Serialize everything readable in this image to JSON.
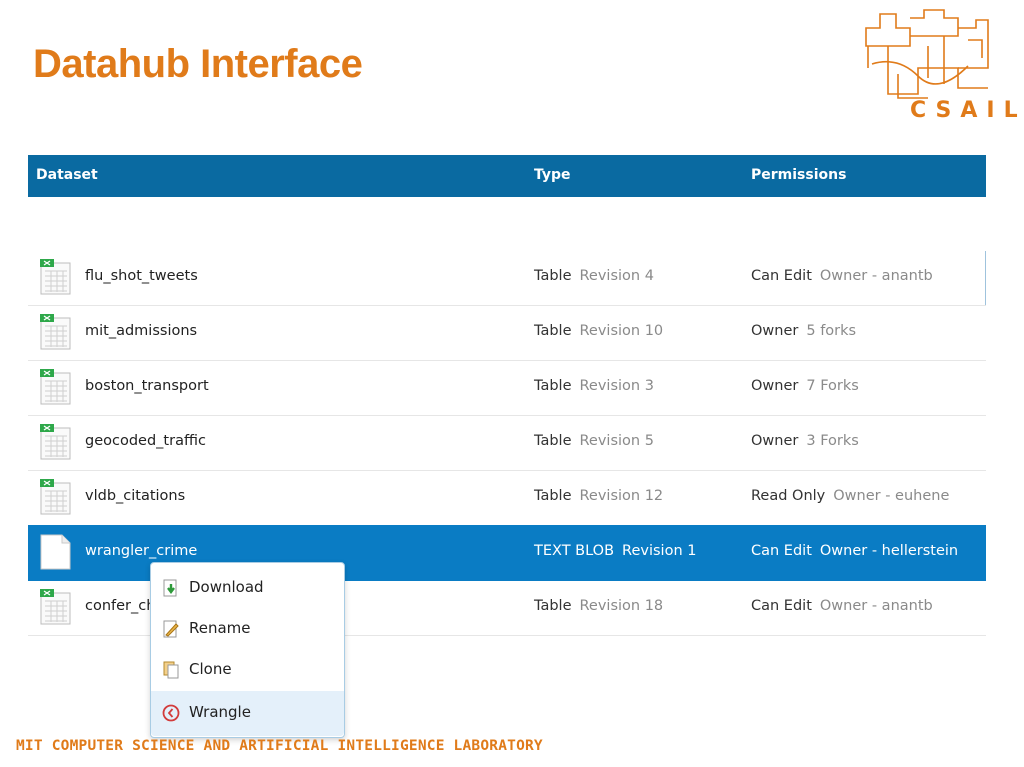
{
  "slide": {
    "title": "Datahub Interface",
    "logo_text": "CSAIL",
    "footer": "MIT COMPUTER SCIENCE AND ARTIFICIAL INTELLIGENCE LABORATORY"
  },
  "table": {
    "headers": {
      "dataset": "Dataset",
      "type": "Type",
      "permissions": "Permissions"
    },
    "rows": [
      {
        "name": "flu_shot_tweets",
        "type": "Table",
        "revision": "Revision 4",
        "permission": "Can Edit",
        "detail": "Owner - anantb",
        "icon": "spreadsheet-icon"
      },
      {
        "name": "mit_admissions",
        "type": "Table",
        "revision": "Revision 10",
        "permission": "Owner",
        "detail": "5 forks",
        "icon": "spreadsheet-icon"
      },
      {
        "name": "boston_transport",
        "type": "Table",
        "revision": "Revision 3",
        "permission": "Owner",
        "detail": "7 Forks",
        "icon": "spreadsheet-icon"
      },
      {
        "name": "geocoded_traffic",
        "type": "Table",
        "revision": "Revision 5",
        "permission": "Owner",
        "detail": "3 Forks",
        "icon": "spreadsheet-icon"
      },
      {
        "name": "vldb_citations",
        "type": "Table",
        "revision": "Revision 12",
        "permission": "Read Only",
        "detail": "Owner - euhene",
        "icon": "spreadsheet-icon"
      },
      {
        "name": "wrangler_crime",
        "type": "TEXT BLOB",
        "revision": "Revision 1",
        "permission": "Can Edit",
        "detail": "Owner - hellerstein",
        "icon": "text-file-icon",
        "selected": true
      },
      {
        "name": "confer_ch",
        "type": "Table",
        "revision": "Revision 18",
        "permission": "Can Edit",
        "detail": "Owner - anantb",
        "icon": "spreadsheet-icon"
      }
    ]
  },
  "context_menu": {
    "items": [
      {
        "label": "Download",
        "icon": "download-icon"
      },
      {
        "label": "Rename",
        "icon": "rename-icon"
      },
      {
        "label": "Clone",
        "icon": "clone-icon"
      },
      {
        "label": "Wrangle",
        "icon": "wrangle-icon",
        "highlighted": true
      }
    ]
  },
  "colors": {
    "accent_orange": "#e07b1a",
    "header_blue": "#0a6aa1",
    "selected_blue": "#0a7cc4"
  }
}
